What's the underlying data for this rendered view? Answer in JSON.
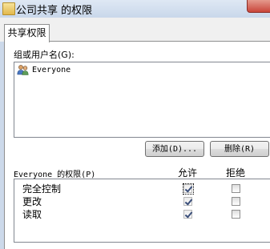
{
  "window": {
    "title": "公司共享 的权限"
  },
  "tabs": [
    {
      "label": "共享权限"
    }
  ],
  "groups_label": "组或用户名(G):",
  "users": [
    {
      "name": "Everyone",
      "icon": "users-group-icon"
    }
  ],
  "buttons": {
    "add": "添加(D)...",
    "remove": "删除(R)"
  },
  "permissions": {
    "header_label": "Everyone 的权限(P)",
    "allow_header": "允许",
    "deny_header": "拒绝",
    "rows": [
      {
        "label": "完全控制",
        "allow": true,
        "deny": false
      },
      {
        "label": "更改",
        "allow": true,
        "deny": false
      },
      {
        "label": "读取",
        "allow": true,
        "deny": false
      }
    ]
  }
}
